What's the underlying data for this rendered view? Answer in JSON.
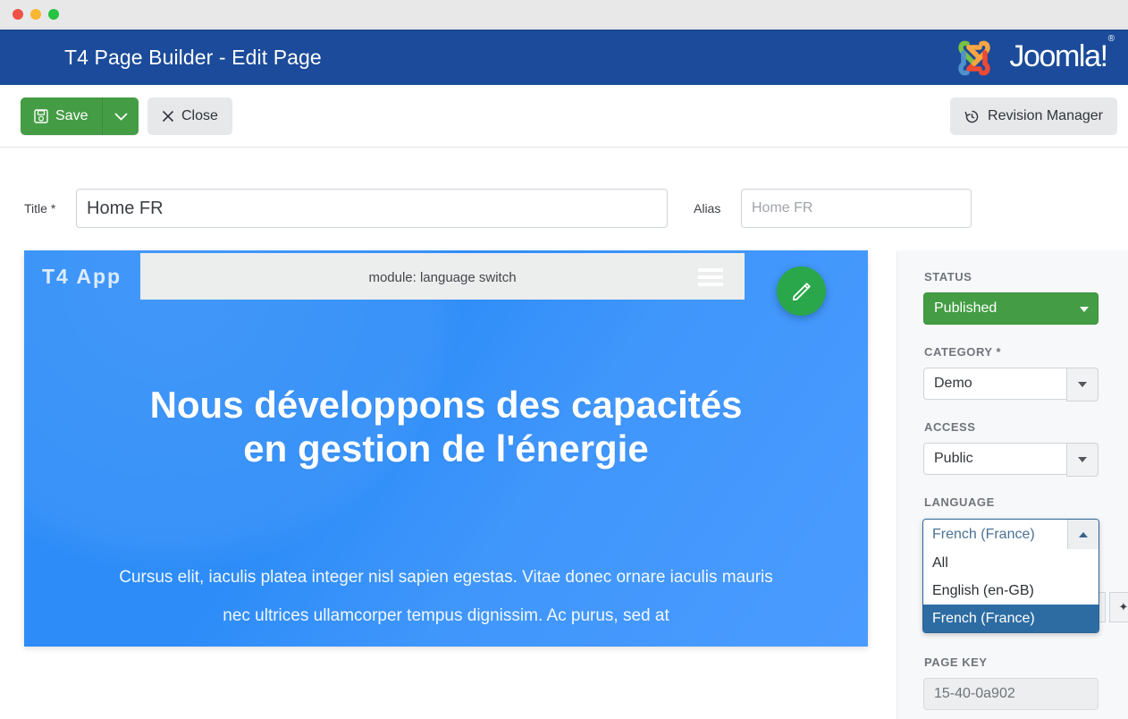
{
  "window": {
    "dots": [
      "close",
      "minimize",
      "zoom"
    ]
  },
  "header": {
    "title": "T4 Page Builder - Edit Page",
    "brand_word": "Joomla!",
    "brand_mark": "joomla-logo-icon",
    "brand_bg": "#1b4b9a"
  },
  "toolbar": {
    "save_label": "Save",
    "save_icon": "floppy-disk-icon",
    "save_dropdown_icon": "chevron-down-icon",
    "close_label": "Close",
    "close_icon": "x-icon",
    "revision_label": "Revision Manager",
    "revision_icon": "history-clock-icon",
    "save_color": "#449d44"
  },
  "fields": {
    "title_label": "Title *",
    "title_value": "Home FR",
    "title_placeholder": "Home FR",
    "alias_label": "Alias",
    "alias_value": "",
    "alias_placeholder": "Home FR"
  },
  "preview": {
    "navbar": {
      "brand": "T4 App",
      "module_label": "module: language switch",
      "menu_icon": "hamburger-menu-icon"
    },
    "edit_fab_icon": "pencil-icon",
    "edit_fab_color": "#2aa74b",
    "hero_heading": "Nous développons des capacités en gestion de l'énergie",
    "hero_paragraph": "Cursus elit, iaculis platea integer nisl sapien egestas. Vitae donec ornare iaculis mauris nec ultrices ullamcorper tempus dignissim. Ac purus, sed at",
    "hero_bg": "#2d8cf8"
  },
  "sidebar": {
    "status_label": "STATUS",
    "status_value": "Published",
    "status_color": "#449d44",
    "category_label": "CATEGORY *",
    "category_value": "Demo",
    "access_label": "ACCESS",
    "access_value": "Public",
    "language_label": "LANGUAGE",
    "language_value": "French (France)",
    "language_options": [
      {
        "label": "All",
        "selected": false
      },
      {
        "label": "English (en-GB)",
        "selected": false
      },
      {
        "label": "French (France)",
        "selected": true
      }
    ],
    "language_toggle_icon": "chevron-up-icon",
    "highlight_color": "#2d6ca2",
    "page_key_label": "PAGE KEY",
    "page_key_value": "15-40-0a902"
  }
}
